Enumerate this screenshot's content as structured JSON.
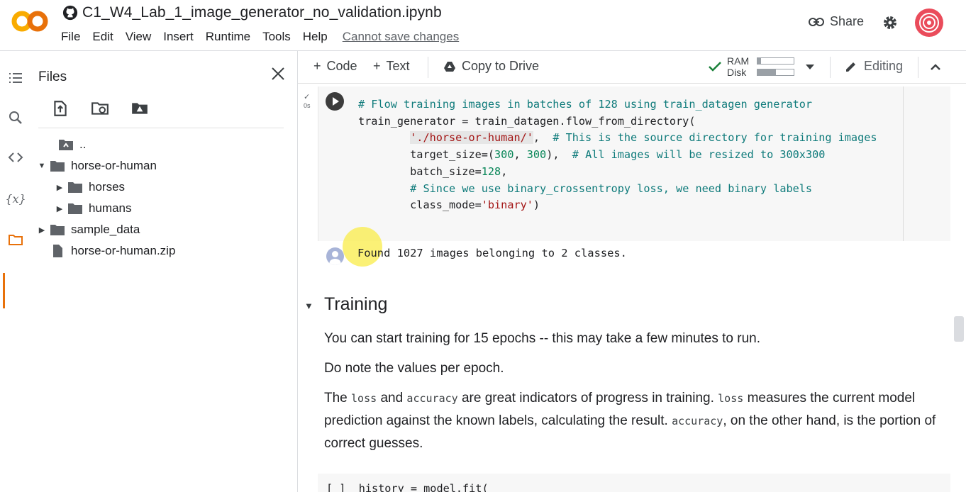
{
  "header": {
    "notebook_title": "C1_W4_Lab_1_image_generator_no_validation.ipynb",
    "menu": [
      "File",
      "Edit",
      "View",
      "Insert",
      "Runtime",
      "Tools",
      "Help"
    ],
    "cannot_save": "Cannot save changes",
    "share_label": "Share"
  },
  "files_panel": {
    "title": "Files",
    "tree": {
      "parent": "..",
      "folder_main": "horse-or-human",
      "sub1": "horses",
      "sub2": "humans",
      "folder_sample": "sample_data",
      "zip": "horse-or-human.zip"
    }
  },
  "toolbar": {
    "code_label": "Code",
    "text_label": "Text",
    "copy_label": "Copy to Drive",
    "ram_label": "RAM",
    "disk_label": "Disk",
    "ram_fraction": 0.1,
    "disk_fraction": 0.5,
    "editing_label": "Editing"
  },
  "cell": {
    "status": "0s",
    "code": {
      "l1": "# Flow training images in batches of 128 using train_datagen generator",
      "l2": "train_generator = train_datagen.flow_from_directory(",
      "l3a": "'./horse-or-human/'",
      "l3b": "# This is the source directory for training images",
      "l4a": "target_size=(",
      "l4n1": "300",
      "l4n2": "300",
      "l4b": "# All images will be resized to 300x300",
      "l5a": "batch_size=",
      "l5n": "128",
      "l6": "# Since we use binary_crossentropy loss, we need binary labels",
      "l7a": "class_mode=",
      "l7s": "'binary'"
    },
    "output": "Found 1027 images belonging to 2 classes."
  },
  "text_cell": {
    "heading": "Training",
    "p1": "You can start training for 15 epochs -- this may take a few minutes to run.",
    "p2": "Do note the values per epoch.",
    "p3_a": "The",
    "p3_loss": "loss",
    "p3_b": "and",
    "p3_accuracy": "accuracy",
    "p3_c": "are great indicators of progress in training.",
    "p3_loss2": "loss",
    "p3_d": "measures the current model prediction against the known labels, calculating the result.",
    "p3_accuracy2": "accuracy",
    "p3_e": ", on the other hand, is the portion of correct guesses."
  },
  "next_cell": {
    "code": "[ ]  history = model.fit("
  }
}
